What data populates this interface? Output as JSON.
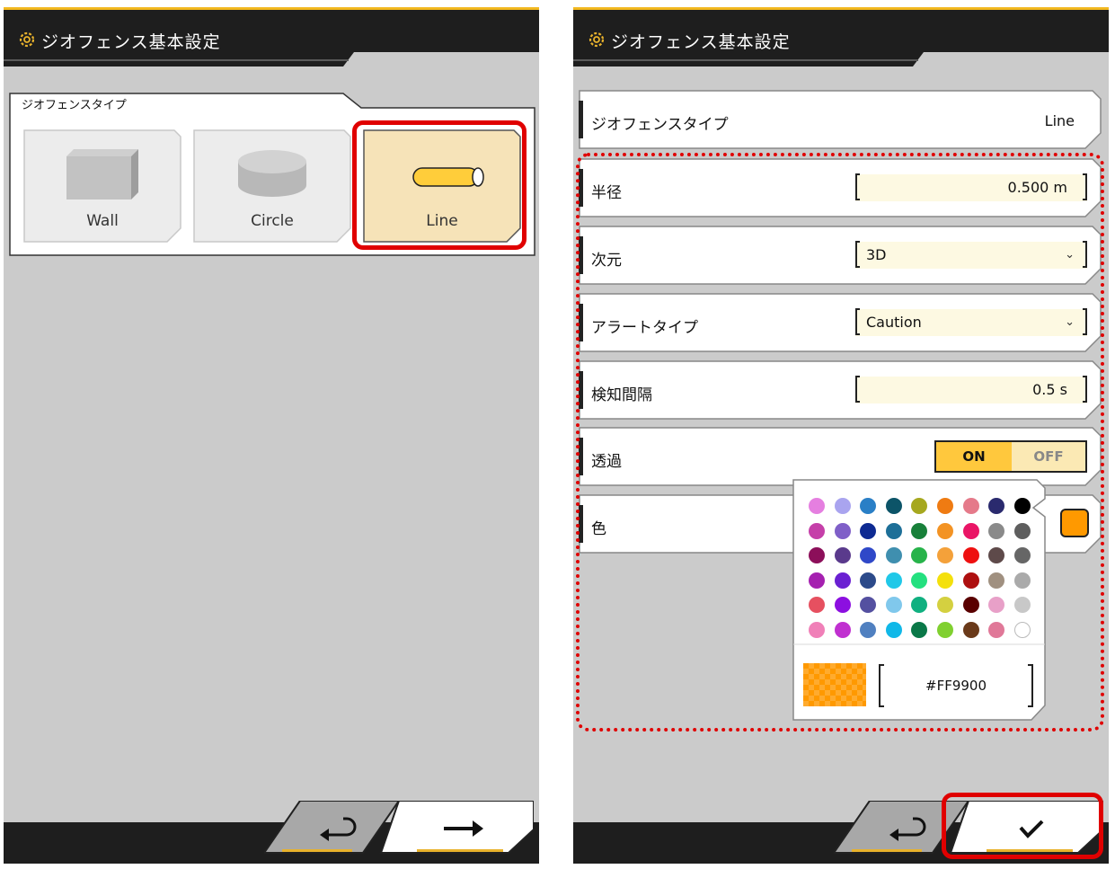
{
  "left_panel": {
    "title": "ジオフェンス基本設定",
    "section_label": "ジオフェンスタイプ",
    "types": [
      {
        "label": "Wall",
        "selected": false
      },
      {
        "label": "Circle",
        "selected": false
      },
      {
        "label": "Line",
        "selected": true
      }
    ],
    "back_icon": "return-arrow-icon",
    "next_icon": "right-arrow-icon"
  },
  "right_panel": {
    "title": "ジオフェンス基本設定",
    "type_row": {
      "label": "ジオフェンスタイプ",
      "value": "Line"
    },
    "radius_row": {
      "label": "半径",
      "value": "0.500 m"
    },
    "dimension_row": {
      "label": "次元",
      "value": "3D"
    },
    "alert_row": {
      "label": "アラートタイプ",
      "value": "Caution"
    },
    "interval_row": {
      "label": "検知間隔",
      "value": "0.5 s"
    },
    "transparency_row": {
      "label": "透過",
      "on_label": "ON",
      "off_label": "OFF",
      "state": "ON"
    },
    "color_row": {
      "label": "色",
      "selected_color": "#FF9900"
    },
    "color_picker": {
      "hex_value": "#FF9900",
      "palette": [
        [
          "#e57fe0",
          "#a9a4ef",
          "#2a7fc6",
          "#0c5468",
          "#a6a81f",
          "#ef7b12",
          "#e57a8a",
          "#2a2a6e",
          "#000000"
        ],
        [
          "#c53fa9",
          "#7f5fc8",
          "#0e2a92",
          "#1d6f98",
          "#18803a",
          "#f39324",
          "#ea1566",
          "#8a8a8a",
          "#5e5e5e"
        ],
        [
          "#8c0f5a",
          "#5a3a8c",
          "#2f48c8",
          "#3f8faf",
          "#27b34a",
          "#f4a13a",
          "#ee1010",
          "#5e4a4a",
          "#666666"
        ],
        [
          "#a520b0",
          "#6a20d2",
          "#2c4a8a",
          "#20c8e8",
          "#24e07f",
          "#f4e00c",
          "#ae0f0f",
          "#a09080",
          "#aaaaaa"
        ],
        [
          "#e65060",
          "#8c0fe0",
          "#5450a0",
          "#80c8ec",
          "#10b080",
          "#d4d040",
          "#5a0000",
          "#e8a0c8",
          "#c8c8c8"
        ],
        [
          "#f080b8",
          "#c030d0",
          "#5080c0",
          "#10b8e8",
          "#0a7848",
          "#80d030",
          "#6a3a1a",
          "#e07898",
          "#ffffff"
        ]
      ]
    },
    "back_icon": "return-arrow-icon",
    "confirm_icon": "checkmark-icon"
  },
  "colors": {
    "accent": "#ffc83d",
    "header": "#1e1e1e",
    "selected_card": "#f6e3b8",
    "highlight": "#e00000"
  }
}
